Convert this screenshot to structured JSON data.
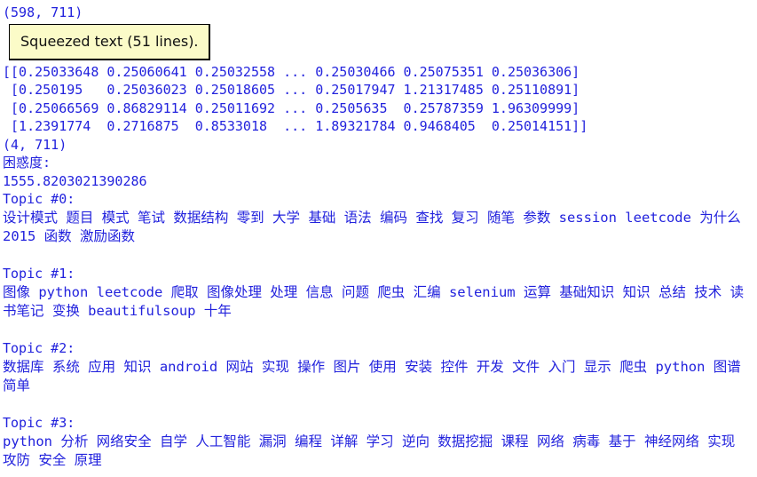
{
  "console": {
    "shape_line_1": "(598, 711)",
    "squeezed_button_label": "Squeezed text (51 lines).",
    "matrix_lines": [
      "[[0.25033648 0.25060641 0.25032558 ... 0.25030466 0.25075351 0.25036306]",
      " [0.250195   0.25036023 0.25018605 ... 0.25017947 1.21317485 0.25110891]",
      " [0.25066569 0.86829114 0.25011692 ... 0.2505635  0.25787359 1.96309999]",
      " [1.2391774  0.2716875  0.8533018  ... 1.89321784 0.9468405  0.25014151]]"
    ],
    "shape_line_2": "(4, 711)",
    "perplexity_label": "困惑度:",
    "perplexity_value": "1555.8203021390286",
    "topics": [
      {
        "header": "Topic #0:",
        "words": "设计模式 题目 模式 笔试 数据结构 零到 大学 基础 语法 编码 查找 复习 随笔 参数 session leetcode 为什么 2015 函数 激励函数"
      },
      {
        "header": "Topic #1:",
        "words": "图像 python leetcode 爬取 图像处理 处理 信息 问题 爬虫 汇编 selenium 运算 基础知识 知识 总结 技术 读书笔记 变换 beautifulsoup 十年"
      },
      {
        "header": "Topic #2:",
        "words": "数据库 系统 应用 知识 android 网站 实现 操作 图片 使用 安装 控件 开发 文件 入门 显示 爬虫 python 图谱 简单"
      },
      {
        "header": "Topic #3:",
        "words": "python 分析 网络安全 自学 人工智能 漏洞 编程 详解 学习 逆向 数据挖掘 课程 网络 病毒 基于 神经网络 实现 攻防 安全 原理"
      }
    ]
  },
  "colors": {
    "stdout_blue": "#2222dd",
    "squeezed_bg": "#fbfbc8",
    "squeezed_border": "#000000",
    "background": "#ffffff"
  }
}
